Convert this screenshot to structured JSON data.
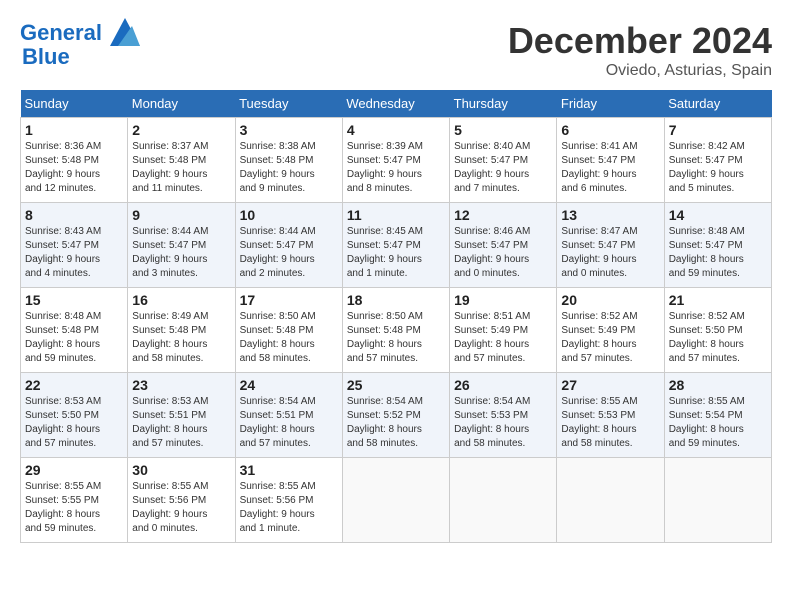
{
  "header": {
    "logo_line1": "General",
    "logo_line2": "Blue",
    "month_title": "December 2024",
    "location": "Oviedo, Asturias, Spain"
  },
  "weekdays": [
    "Sunday",
    "Monday",
    "Tuesday",
    "Wednesday",
    "Thursday",
    "Friday",
    "Saturday"
  ],
  "days": [
    {
      "num": "1",
      "info": "Sunrise: 8:36 AM\nSunset: 5:48 PM\nDaylight: 9 hours\nand 12 minutes."
    },
    {
      "num": "2",
      "info": "Sunrise: 8:37 AM\nSunset: 5:48 PM\nDaylight: 9 hours\nand 11 minutes."
    },
    {
      "num": "3",
      "info": "Sunrise: 8:38 AM\nSunset: 5:48 PM\nDaylight: 9 hours\nand 9 minutes."
    },
    {
      "num": "4",
      "info": "Sunrise: 8:39 AM\nSunset: 5:47 PM\nDaylight: 9 hours\nand 8 minutes."
    },
    {
      "num": "5",
      "info": "Sunrise: 8:40 AM\nSunset: 5:47 PM\nDaylight: 9 hours\nand 7 minutes."
    },
    {
      "num": "6",
      "info": "Sunrise: 8:41 AM\nSunset: 5:47 PM\nDaylight: 9 hours\nand 6 minutes."
    },
    {
      "num": "7",
      "info": "Sunrise: 8:42 AM\nSunset: 5:47 PM\nDaylight: 9 hours\nand 5 minutes."
    },
    {
      "num": "8",
      "info": "Sunrise: 8:43 AM\nSunset: 5:47 PM\nDaylight: 9 hours\nand 4 minutes."
    },
    {
      "num": "9",
      "info": "Sunrise: 8:44 AM\nSunset: 5:47 PM\nDaylight: 9 hours\nand 3 minutes."
    },
    {
      "num": "10",
      "info": "Sunrise: 8:44 AM\nSunset: 5:47 PM\nDaylight: 9 hours\nand 2 minutes."
    },
    {
      "num": "11",
      "info": "Sunrise: 8:45 AM\nSunset: 5:47 PM\nDaylight: 9 hours\nand 1 minute."
    },
    {
      "num": "12",
      "info": "Sunrise: 8:46 AM\nSunset: 5:47 PM\nDaylight: 9 hours\nand 0 minutes."
    },
    {
      "num": "13",
      "info": "Sunrise: 8:47 AM\nSunset: 5:47 PM\nDaylight: 9 hours\nand 0 minutes."
    },
    {
      "num": "14",
      "info": "Sunrise: 8:48 AM\nSunset: 5:47 PM\nDaylight: 8 hours\nand 59 minutes."
    },
    {
      "num": "15",
      "info": "Sunrise: 8:48 AM\nSunset: 5:48 PM\nDaylight: 8 hours\nand 59 minutes."
    },
    {
      "num": "16",
      "info": "Sunrise: 8:49 AM\nSunset: 5:48 PM\nDaylight: 8 hours\nand 58 minutes."
    },
    {
      "num": "17",
      "info": "Sunrise: 8:50 AM\nSunset: 5:48 PM\nDaylight: 8 hours\nand 58 minutes."
    },
    {
      "num": "18",
      "info": "Sunrise: 8:50 AM\nSunset: 5:48 PM\nDaylight: 8 hours\nand 57 minutes."
    },
    {
      "num": "19",
      "info": "Sunrise: 8:51 AM\nSunset: 5:49 PM\nDaylight: 8 hours\nand 57 minutes."
    },
    {
      "num": "20",
      "info": "Sunrise: 8:52 AM\nSunset: 5:49 PM\nDaylight: 8 hours\nand 57 minutes."
    },
    {
      "num": "21",
      "info": "Sunrise: 8:52 AM\nSunset: 5:50 PM\nDaylight: 8 hours\nand 57 minutes."
    },
    {
      "num": "22",
      "info": "Sunrise: 8:53 AM\nSunset: 5:50 PM\nDaylight: 8 hours\nand 57 minutes."
    },
    {
      "num": "23",
      "info": "Sunrise: 8:53 AM\nSunset: 5:51 PM\nDaylight: 8 hours\nand 57 minutes."
    },
    {
      "num": "24",
      "info": "Sunrise: 8:54 AM\nSunset: 5:51 PM\nDaylight: 8 hours\nand 57 minutes."
    },
    {
      "num": "25",
      "info": "Sunrise: 8:54 AM\nSunset: 5:52 PM\nDaylight: 8 hours\nand 58 minutes."
    },
    {
      "num": "26",
      "info": "Sunrise: 8:54 AM\nSunset: 5:53 PM\nDaylight: 8 hours\nand 58 minutes."
    },
    {
      "num": "27",
      "info": "Sunrise: 8:55 AM\nSunset: 5:53 PM\nDaylight: 8 hours\nand 58 minutes."
    },
    {
      "num": "28",
      "info": "Sunrise: 8:55 AM\nSunset: 5:54 PM\nDaylight: 8 hours\nand 59 minutes."
    },
    {
      "num": "29",
      "info": "Sunrise: 8:55 AM\nSunset: 5:55 PM\nDaylight: 8 hours\nand 59 minutes."
    },
    {
      "num": "30",
      "info": "Sunrise: 8:55 AM\nSunset: 5:56 PM\nDaylight: 9 hours\nand 0 minutes."
    },
    {
      "num": "31",
      "info": "Sunrise: 8:55 AM\nSunset: 5:56 PM\nDaylight: 9 hours\nand 1 minute."
    }
  ]
}
